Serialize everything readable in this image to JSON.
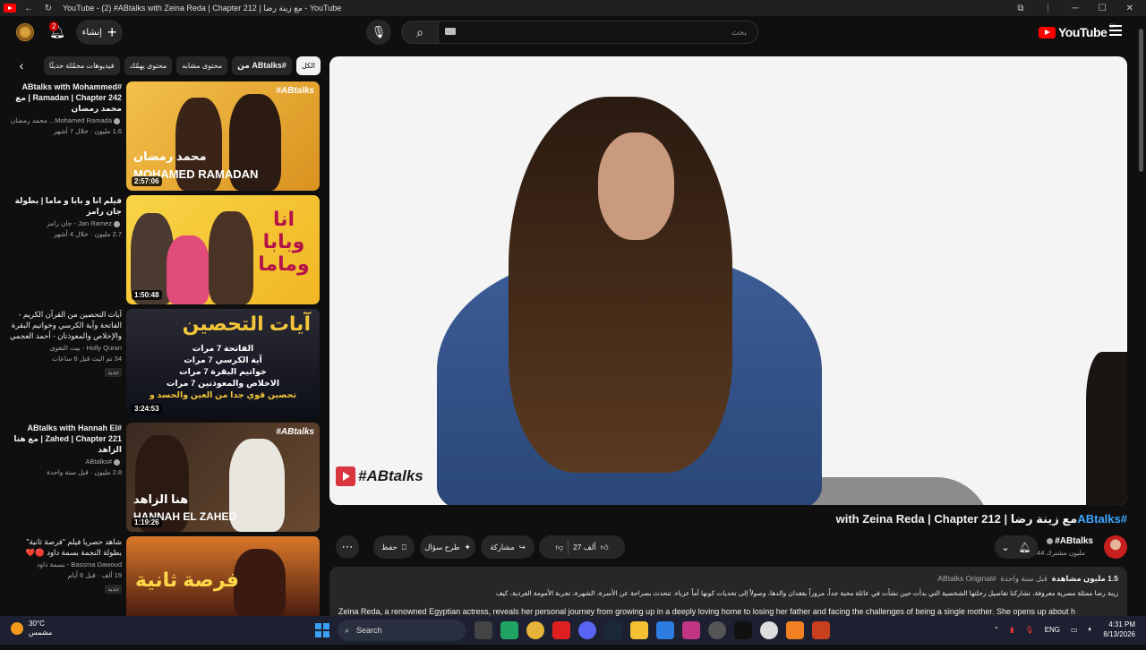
{
  "window": {
    "title": "YouTube - (2) #ABtalks with Zeina Reda | Chapter 212 | مع زينة رضا - YouTube"
  },
  "masthead": {
    "notif_count": "2",
    "create_label": "إنشاء",
    "search_placeholder": "بحث",
    "logo_text": "YouTube",
    "country_code": "SA"
  },
  "chips": [
    {
      "label": "الكل",
      "active": true
    },
    {
      "label": "من ABtalks#",
      "bold": true
    },
    {
      "label": "محتوى مشابه"
    },
    {
      "label": "محتوى يهمّك"
    },
    {
      "label": "فيديوهات محمّلة حديثًا"
    }
  ],
  "recommendations": [
    {
      "title": "#ABtalks with Mohammed Ramadan | Chapter 242 | مع محمد رمضان",
      "channel": "Mohamed Ramada... محمد رمضان",
      "stats": "1.6 مليون  · خلال 7 أشهر",
      "duration": "2:57:06",
      "thumb_text": "محمد رمضان",
      "thumb_text2": "MOHAMED RAMADAN",
      "thumb_tag": "#ABtalks"
    },
    {
      "title": "فيلم انا و بابا و ماما | بطولة جان رامز",
      "channel": "Jan Ramez - جان رامز",
      "stats": "2.7 مليون  · خلال 4 أشهر",
      "duration": "1:50:48",
      "thumb_text": "انا وبابا وماما"
    },
    {
      "title": "آيات التحصين من القرآن الكريم - الفاتحة وآية الكرسي وخواتيم البقرة والإخلاص والمعوذتان - أحمد العجمي",
      "channel": "Holly Quran - بيت التقوى",
      "stats": "34 تم البث قبل 6 ساعات",
      "badge": "جديد",
      "duration": "3:24:53",
      "thumb_text": "آيات التحصين",
      "thumb_lines": [
        "الفاتحة 7 مرات",
        "آية الكرسي 7 مرات",
        "خواتيم البقرة 7 مرات",
        "الاخلاص والمعوذتين 7 مرات",
        "تحصين قوي جدا من العين والحسد و"
      ]
    },
    {
      "title": "#ABtalks with Hannah El Zahed | Chapter 221 | مع هنا الزاهد",
      "channel": "#ABtalks",
      "stats": "2.8 مليون  · قبل سنة واحدة",
      "duration": "1:19:26",
      "thumb_text": "هنا الزاهد",
      "thumb_text2": "HANNAH EL ZAHED",
      "thumb_tag": "#ABtalks"
    },
    {
      "title": "شاهد حصريا فيلم \"فرصة ثانية\" بطولة النجمة بسمة داود 🔴❤️",
      "channel": "Bassma Dawoud - بسمة داود",
      "stats": "19 ألف · قبل 6 أيام",
      "badge": "جديد",
      "thumb_text": "فرصة ثانية"
    }
  ],
  "video": {
    "watermark": "#ABtalks",
    "title_hash": "#ABtalks",
    "title_rest": "مع زينة رضا | with Zeina Reda | Chapter 212"
  },
  "channel": {
    "name": "#ABtalks",
    "subs": "3.44 مليون مشترك"
  },
  "actions": {
    "likes": "27 ألف",
    "share": "مشاركة",
    "ask": "طرح سؤال",
    "save": "حفظ"
  },
  "description": {
    "views": "1.5 مليون مشاهدة",
    "age": "قبل سنة واحدة",
    "tag": "#ABtalks Original",
    "arabic": "زينة رضا ممثلة مصرية معروفة، تشاركنا تفاصيل رحلتها الشخصية التي بدأت حين نشأت في عائلة محبة جداً، مروراً بفقدان والدها، وصولاً إلى تحديات كونها أماً عزباء. تتحدث بصراحة عن الأسرة، الشهرة، تجربة الأمومة الفردية، كيف",
    "english": "Zeina Reda, a renowned Egyptian actress, reveals her personal journey from growing up in a deeply loving home to losing her father and facing the challenges of being a single mother. She opens up about h"
  },
  "taskbar": {
    "temp": "30°C",
    "weather": "مشمس",
    "search": "Search",
    "lang": "ENG",
    "time": "4:31 PM",
    "date": "8/13/2026"
  }
}
